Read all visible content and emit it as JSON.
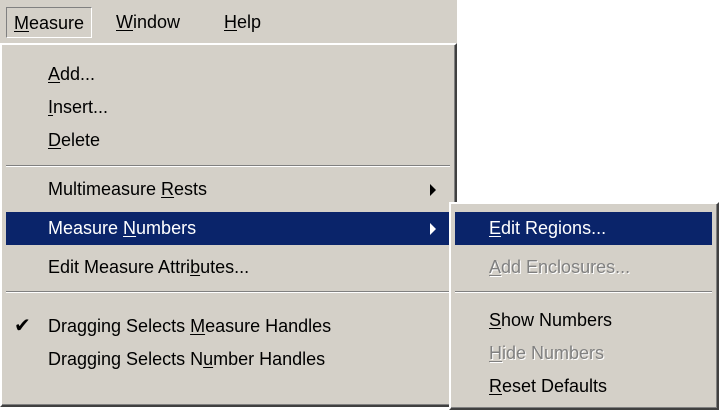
{
  "menubar": {
    "items": [
      {
        "pre": "",
        "key": "M",
        "post": "easure"
      },
      {
        "pre": "",
        "key": "W",
        "post": "indow"
      },
      {
        "pre": "",
        "key": "H",
        "post": "elp"
      }
    ]
  },
  "measure_menu": {
    "items": [
      {
        "pre": "",
        "key": "A",
        "post": "dd..."
      },
      {
        "pre": "",
        "key": "I",
        "post": "nsert..."
      },
      {
        "pre": "",
        "key": "D",
        "post": "elete"
      },
      {
        "pre": "Multimeasure ",
        "key": "R",
        "post": "ests",
        "submenu_arrow": "right-triangle-icon"
      },
      {
        "pre": "Measure ",
        "key": "N",
        "post": "umbers",
        "submenu_arrow": "right-triangle-icon",
        "state": "selected"
      },
      {
        "pre": "Edit Measure Attri",
        "key": "b",
        "post": "utes..."
      },
      {
        "pre": "Dragging Selects ",
        "key": "M",
        "post": "easure Handles",
        "check_glyph": "✔",
        "checked": true
      },
      {
        "pre": "Dragging Selects N",
        "key": "u",
        "post": "mber Handles",
        "checked": false
      }
    ]
  },
  "measure_numbers_submenu": {
    "items": [
      {
        "pre": "",
        "key": "E",
        "post": "dit Regions...",
        "state": "selected"
      },
      {
        "pre": "",
        "key": "A",
        "post": "dd Enclosures...",
        "state": "disabled"
      },
      {
        "pre": "",
        "key": "S",
        "post": "how Numbers"
      },
      {
        "pre": "",
        "key": "H",
        "post": "ide Numbers",
        "state": "disabled"
      },
      {
        "pre": "",
        "key": "R",
        "post": "eset Defaults"
      }
    ]
  },
  "colors": {
    "menu_face": "#d4d0c8",
    "highlight": "#0a246a",
    "highlight_text": "#ffffff",
    "disabled_text": "#808080"
  }
}
